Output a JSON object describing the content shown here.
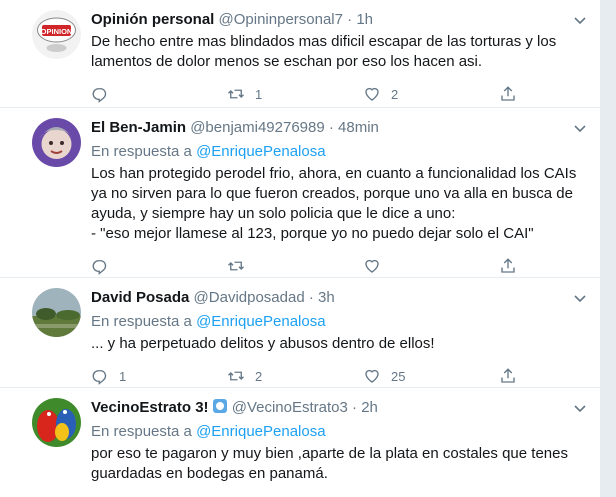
{
  "tweets": [
    {
      "name": "Opinión personal",
      "handle": "@Opininpersonal7",
      "dot": "·",
      "time": "1h",
      "text": "De hecho entre mas blindados mas dificil escapar de las torturas y los lamentos de dolor menos se eschan por eso los hacen asi.",
      "reply_prefix": "",
      "reply_to": "",
      "replies": "",
      "retweets": "1",
      "likes": "2",
      "avatar_icon": "opinion-sign-icon",
      "avatar_label": "OPINION"
    },
    {
      "name": "El Ben-Jamin",
      "handle": "@benjami49276989",
      "dot": "·",
      "time": "48min",
      "reply_prefix": "En respuesta a",
      "reply_to": "@EnriquePenalosa",
      "text": "Los han protegido perodel frio, ahora, en cuanto a funcionalidad los CAIs ya no sirven para lo que fueron creados, porque  uno va alla en busca de ayuda, y siempre hay un solo policia que le dice a uno:\n- \"eso mejor llamese al 123, porque yo no puedo dejar solo el CAI\"",
      "replies": "",
      "retweets": "",
      "likes": "",
      "avatar_icon": "person-photo-icon"
    },
    {
      "name": "David Posada",
      "handle": "@Davidposadad",
      "dot": "·",
      "time": "3h",
      "reply_prefix": "En respuesta a",
      "reply_to": "@EnriquePenalosa",
      "text": "... y ha perpetuado delitos y abusos dentro de ellos!",
      "replies": "1",
      "retweets": "2",
      "likes": "25",
      "avatar_icon": "landscape-photo-icon"
    },
    {
      "name": "VecinoEstrato 3!",
      "handle": "@VecinoEstrato3",
      "dot": "·",
      "time": "2h",
      "reply_prefix": "En respuesta a",
      "reply_to": "@EnriquePenalosa",
      "text": "por eso te pagaron y muy bien ,aparte de la plata en costales que tenes guardadas en bodegas en panamá.",
      "replies": "",
      "retweets": "",
      "likes": "",
      "avatar_icon": "parrot-photo-icon",
      "badge_icon": "blue-square-emoji-icon"
    }
  ],
  "colors": {
    "link": "#1da1f2",
    "muted": "#657786",
    "text": "#14171a",
    "border": "#e6ecf0"
  }
}
